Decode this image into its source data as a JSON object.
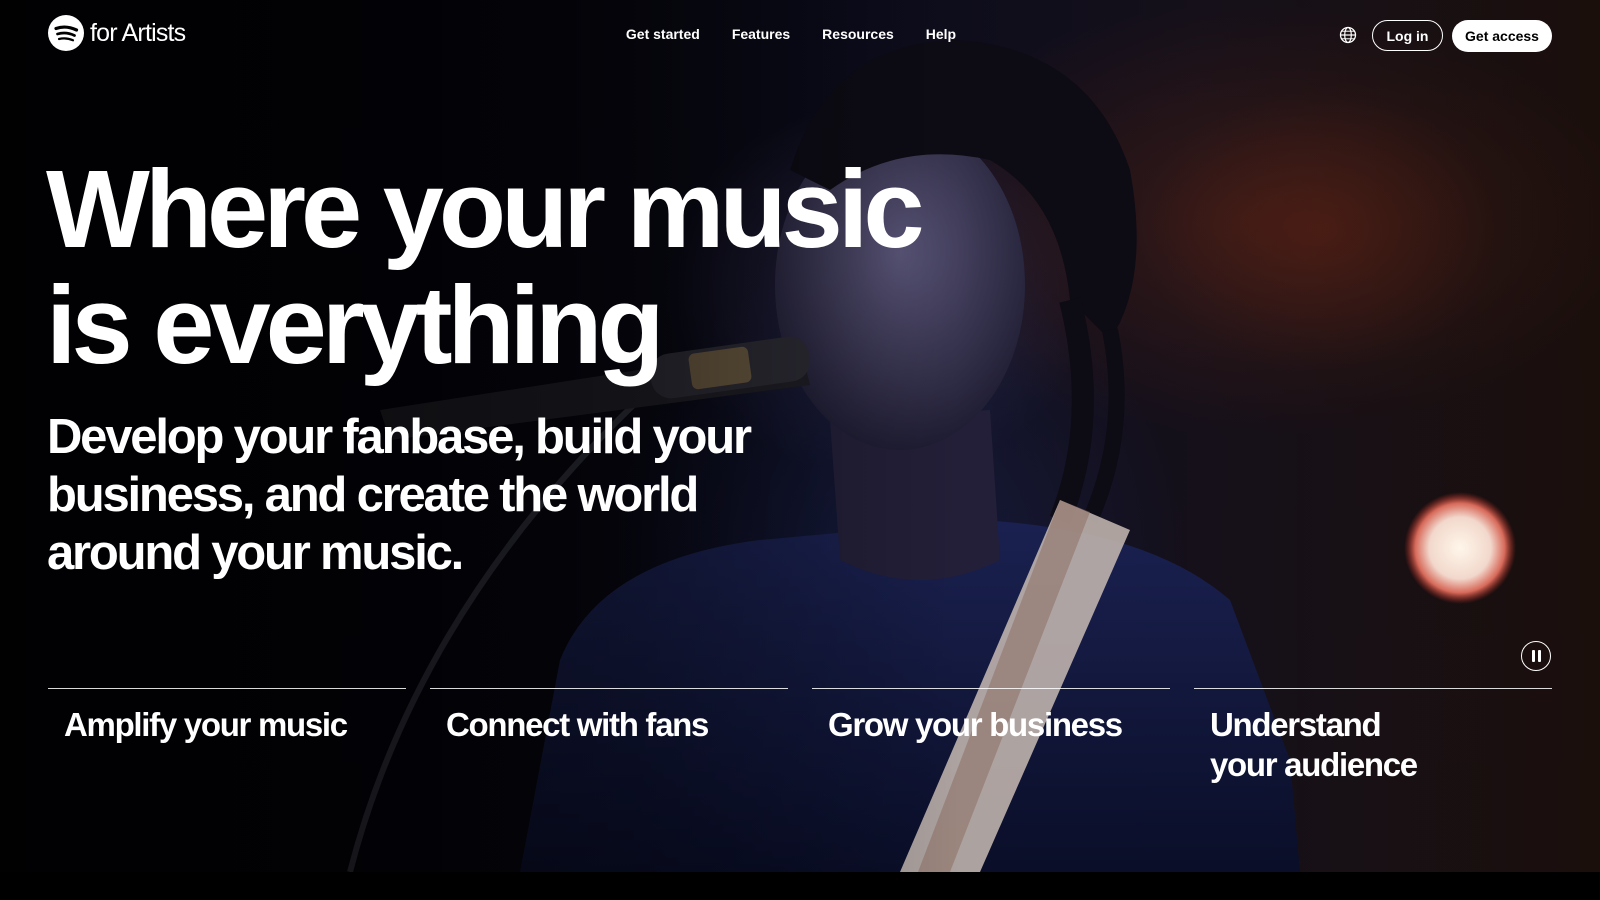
{
  "brand": {
    "wordmark": "for Artists",
    "logo_icon": "spotify-logo-icon"
  },
  "nav": {
    "items": [
      {
        "label": "Get started"
      },
      {
        "label": "Features"
      },
      {
        "label": "Resources"
      },
      {
        "label": "Help"
      }
    ]
  },
  "header_actions": {
    "language_icon": "globe-icon",
    "login_label": "Log in",
    "get_access_label": "Get access"
  },
  "hero": {
    "headline_line1": "Where your music",
    "headline_line2": "is everything",
    "subheading": "Develop your fanbase, build your business, and create the world around your music.",
    "pause_icon": "pause-icon"
  },
  "features": [
    {
      "line1": "Amplify your music",
      "line2": ""
    },
    {
      "line1": "Connect with fans",
      "line2": ""
    },
    {
      "line1": "Grow your business",
      "line2": ""
    },
    {
      "line1": "Understand",
      "line2": "your audience"
    }
  ],
  "colors": {
    "background": "#000000",
    "text": "#ffffff",
    "button_primary_bg": "#ffffff",
    "button_primary_text": "#000000"
  }
}
